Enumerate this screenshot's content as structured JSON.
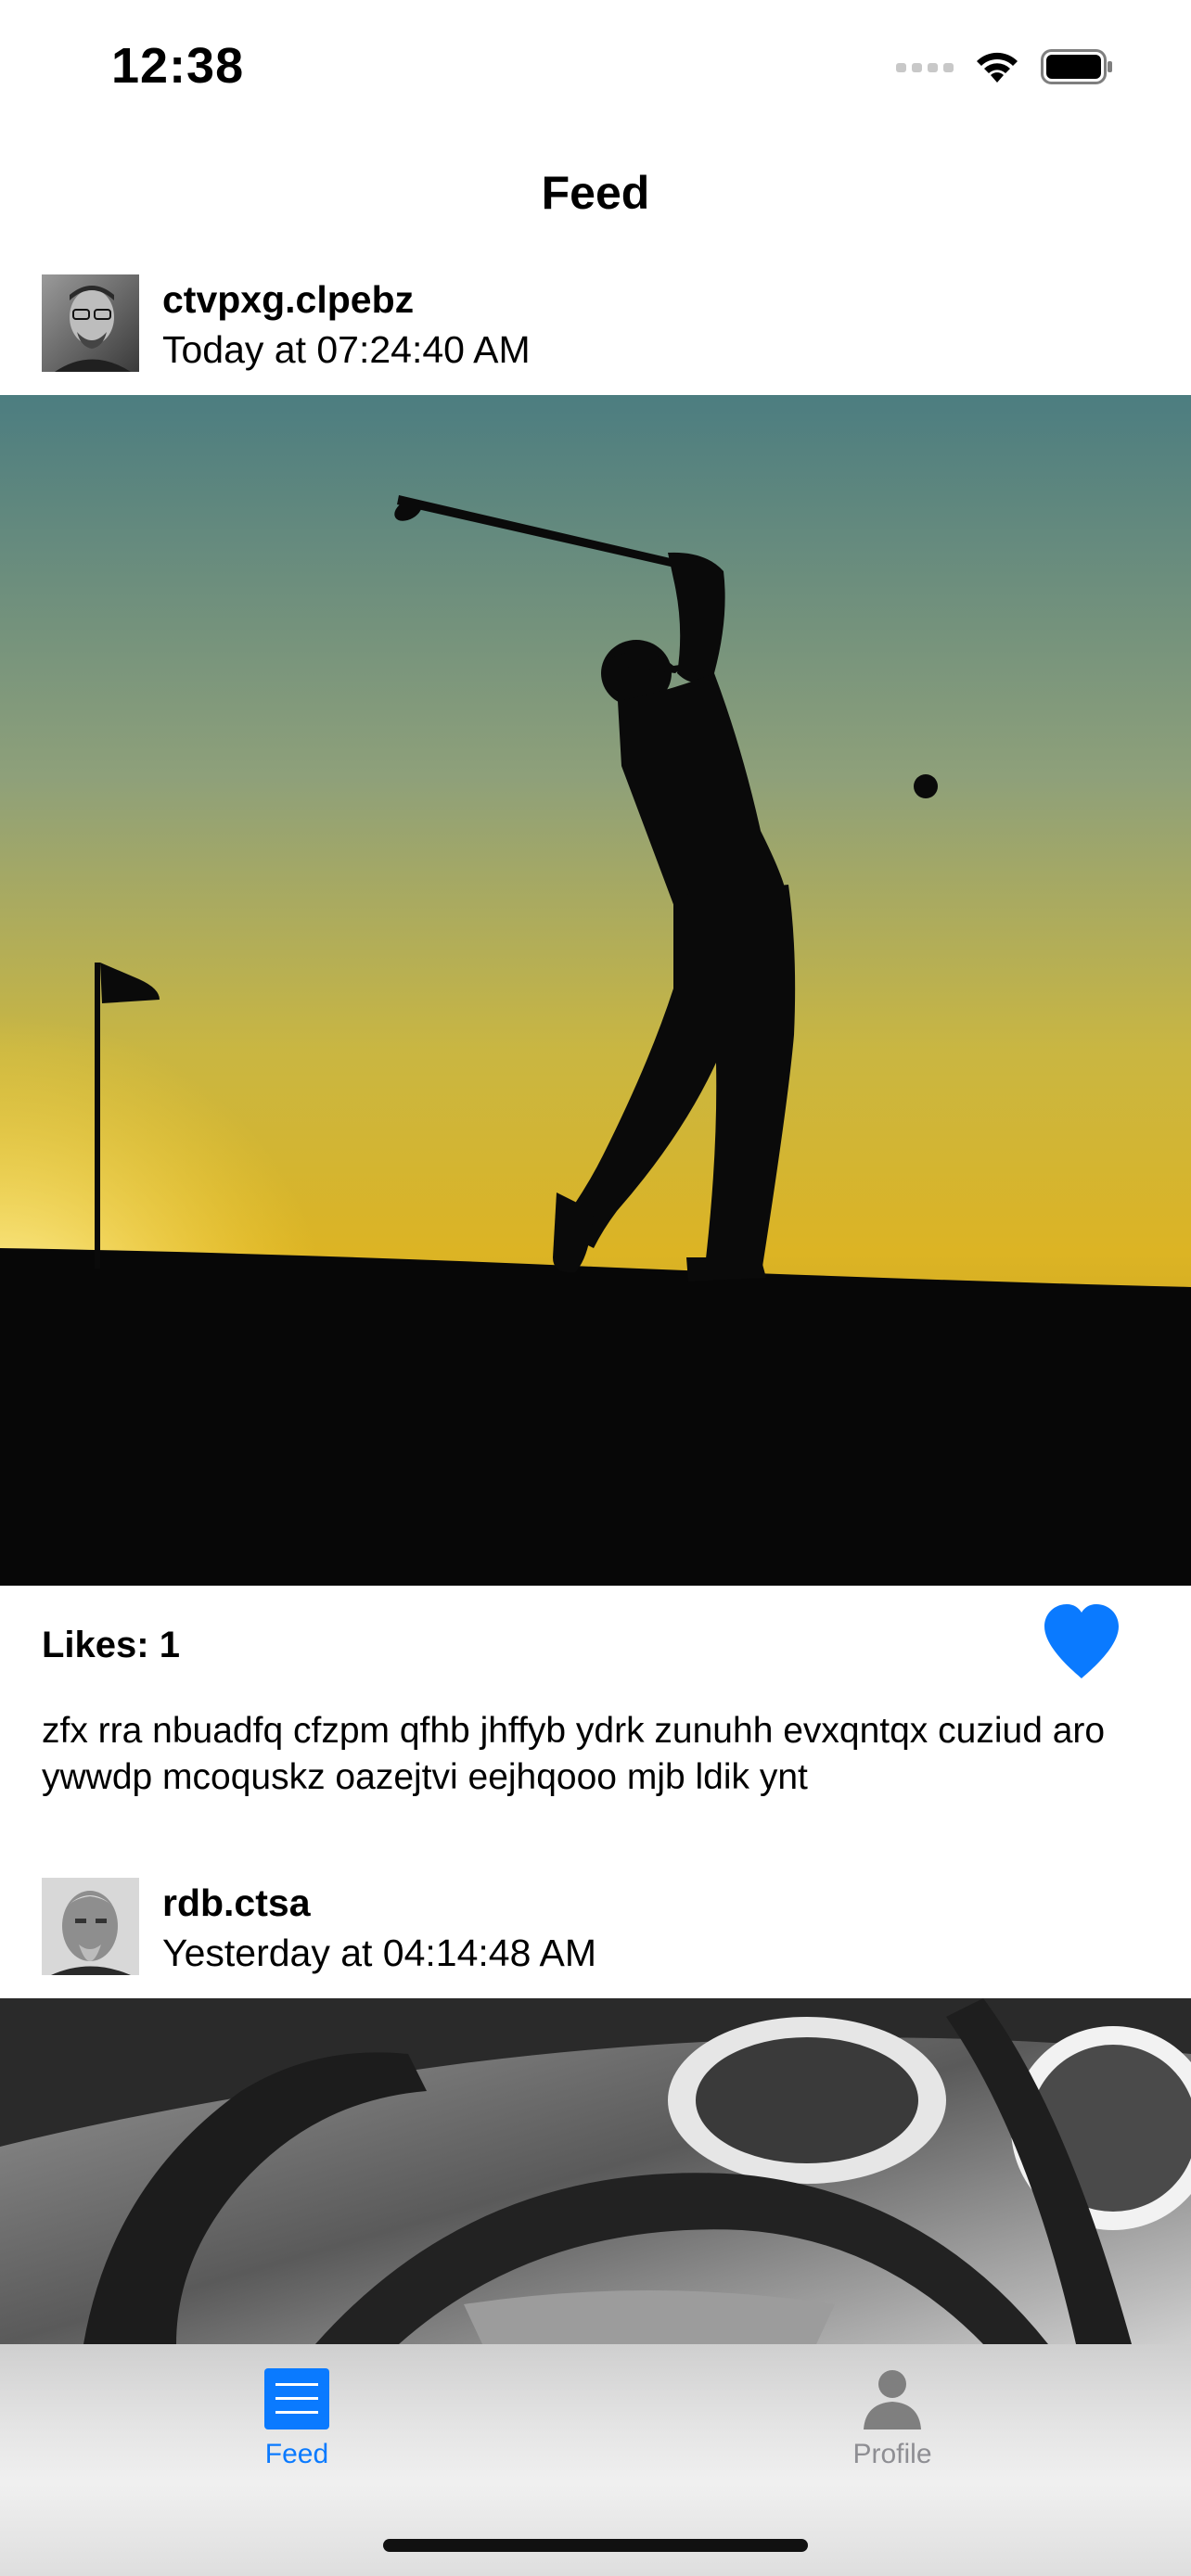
{
  "status_bar": {
    "time": "12:38"
  },
  "nav": {
    "title": "Feed"
  },
  "posts": [
    {
      "username": "ctvpxg.clpebz",
      "timestamp": "Today at 07:24:40 AM",
      "likes_label": "Likes: 1",
      "caption": "zfx rra nbuadfq cfzpm qfhb jhffyb ydrk zunuhh evxqntqx cuziud aro ywwdp mcoquskz oazejtvi eejhqooo mjb ldik ynt",
      "liked": true
    },
    {
      "username": "rdb.ctsa",
      "timestamp": "Yesterday at 04:14:48 AM"
    }
  ],
  "tabs": [
    {
      "label": "Feed",
      "icon": "list-icon",
      "active": true
    },
    {
      "label": "Profile",
      "icon": "person-icon",
      "active": false
    }
  ],
  "colors": {
    "accent": "#0A7AFF",
    "inactive_tab": "#8E8E93"
  }
}
